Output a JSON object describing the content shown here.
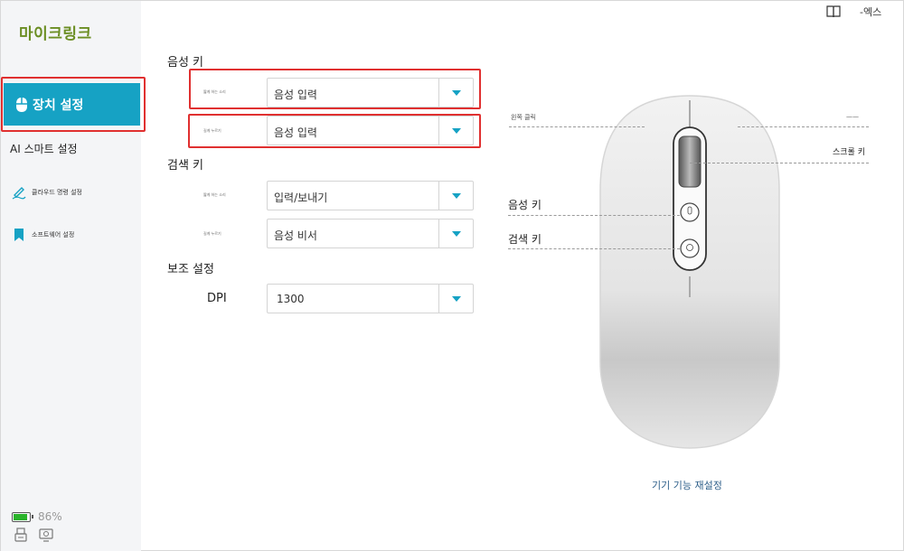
{
  "app": {
    "title": "마이크링크"
  },
  "topbar": {
    "lang_label": "-엑스",
    "manual_icon": "book-icon"
  },
  "sidebar": {
    "items": [
      {
        "label": "장치 설정",
        "icon": "mouse-icon",
        "active": true
      },
      {
        "label": "AI 스마트 설정"
      },
      {
        "label": "클라우드 명령 설정",
        "icon": "pen-icon"
      },
      {
        "label": "소프트웨어 설정",
        "icon": "bookmark-icon"
      }
    ],
    "battery_text": "86%",
    "battery_level": 0.86
  },
  "voice_key": {
    "title": "음성 키",
    "rows": [
      {
        "label": "짧게 하는 소리",
        "value": "음성 입력"
      },
      {
        "label": "길게 누르기",
        "value": "음성 입력"
      }
    ]
  },
  "search_key": {
    "title": "검색 키",
    "rows": [
      {
        "label": "짧게 하는 소리",
        "value": "입력/보내기"
      },
      {
        "label": "길게 누르기",
        "value": "음성 비서"
      }
    ]
  },
  "aux": {
    "title": "보조 설정",
    "dpi_label": "DPI",
    "dpi_value": "1300"
  },
  "mouse": {
    "left_click": "왼쪽 클릭",
    "right_click": "——",
    "scroll_key": "스크롤 키",
    "voice_key": "음성 키",
    "search_key": "검색 키"
  },
  "reset_label": "기기 기능 재설정",
  "colors": {
    "accent": "#16a2c4",
    "highlight": "#e03030",
    "brand": "#6b8e23",
    "battery": "#2ab32a"
  }
}
